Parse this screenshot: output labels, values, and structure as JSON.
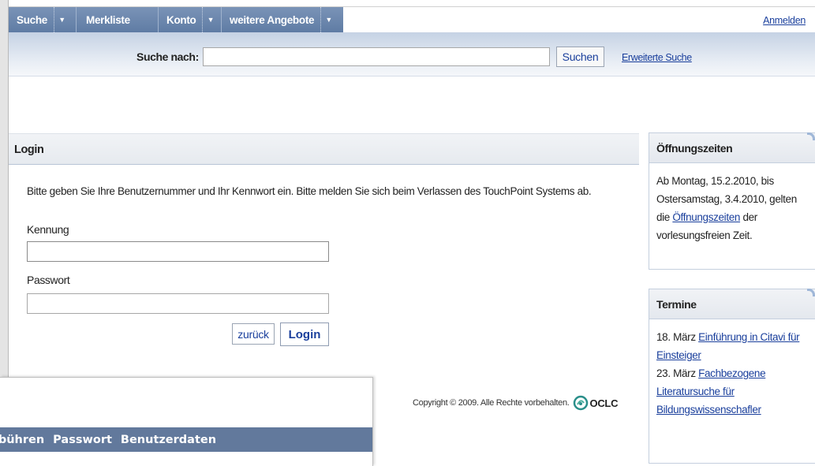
{
  "nav": {
    "items": [
      {
        "label": "Suche"
      },
      {
        "label": "Merkliste"
      },
      {
        "label": "Konto"
      },
      {
        "label": "weitere Angebote"
      }
    ],
    "dropdown_arrow": "▼",
    "login_link": "Anmelden"
  },
  "search": {
    "label": "Suche nach:",
    "value": "",
    "button": "Suchen",
    "advanced_link": "Erweiterte Suche"
  },
  "login": {
    "title": "Login",
    "intro": "Bitte geben Sie Ihre Benutzernummer und Ihr Kennwort ein. Bitte melden Sie sich beim Verlassen des TouchPoint Systems ab.",
    "kennung_label": "Kennung",
    "kennung_value": "",
    "passwort_label": "Passwort",
    "passwort_value": "",
    "back_button": "zurück",
    "login_button": "Login"
  },
  "footer": {
    "copyright": "Copyright © 2009. Alle Rechte vorbehalten.",
    "logo_text": "OCLC"
  },
  "sidebar": {
    "oeffnungszeiten": {
      "title": "Öffnungszeiten",
      "text_before": "Ab Montag, 15.2.2010, bis Ostersamstag, 3.4.2010, gelten die ",
      "link": "Öffnungszeiten",
      "text_after": " der vorlesungsfreien Zeit."
    },
    "termine": {
      "title": "Termine",
      "items": [
        {
          "date": "18. März ",
          "link": "Einführung in Citavi für Einsteiger"
        },
        {
          "date": "23. März ",
          "link": "Fachbezogene Literatursuche für Bildungswissenschafler"
        }
      ]
    }
  },
  "overlay": {
    "menu": [
      "ebühren",
      "Passwort",
      "Benutzerdaten"
    ]
  },
  "colors": {
    "nav_bg": "#6a85ac",
    "link": "#1a3f9c",
    "overlay_bar": "#62799c"
  }
}
